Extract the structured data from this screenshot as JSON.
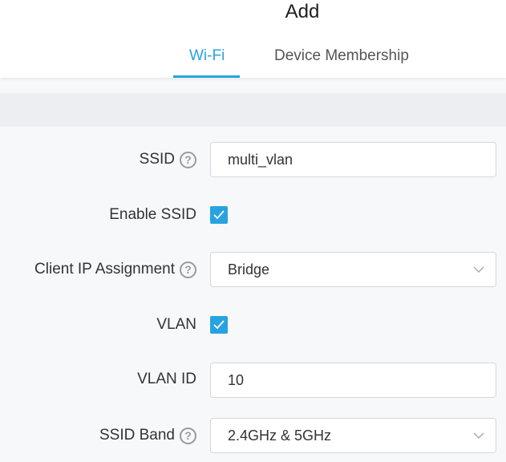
{
  "header": {
    "title": "Add",
    "tabs": [
      {
        "label": "Wi-Fi",
        "active": true
      },
      {
        "label": "Device Membership",
        "active": false
      }
    ]
  },
  "colors": {
    "accent": "#28a3e0",
    "band": "#eceef1",
    "background": "#f7f8fa"
  },
  "form": {
    "ssid": {
      "label": "SSID",
      "value": "multi_vlan",
      "help_icon": "help-circle-icon"
    },
    "enable_ssid": {
      "label": "Enable SSID",
      "checked": true
    },
    "client_ip": {
      "label": "Client IP Assignment",
      "value": "Bridge",
      "help_icon": "help-circle-icon"
    },
    "vlan": {
      "label": "VLAN",
      "checked": true
    },
    "vlan_id": {
      "label": "VLAN ID",
      "value": "10"
    },
    "ssid_band": {
      "label": "SSID Band",
      "value": "2.4GHz & 5GHz",
      "help_icon": "help-circle-icon"
    }
  },
  "help_glyph": "?"
}
